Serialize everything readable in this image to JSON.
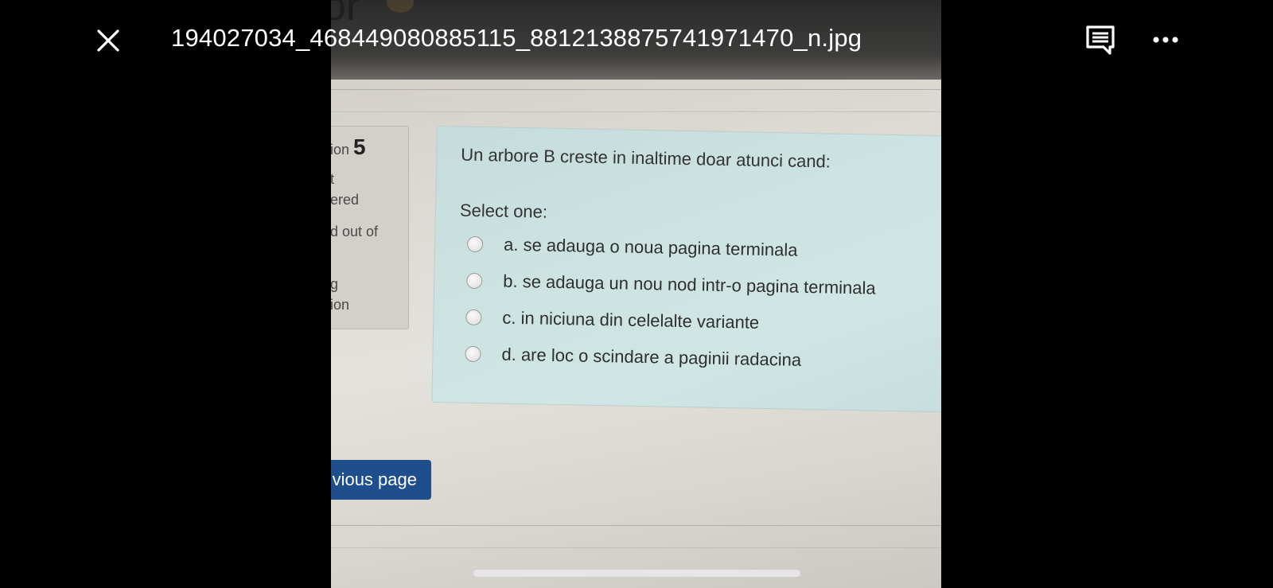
{
  "viewer": {
    "filename": "194027034_468449080885115_8812138875741971470_n.jpg",
    "close_icon": "close-icon",
    "comment_icon": "comment-icon",
    "more_icon": "more-options-icon"
  },
  "photo": {
    "ghost_text": "or",
    "sidebar": {
      "question_label": "ion",
      "question_number": "5",
      "status_line1": "t",
      "status_line2": "ered",
      "marks_line": "d out of",
      "flag_line1": "g",
      "flag_line2": "ion"
    },
    "question": {
      "text": "Un arbore B creste in inaltime doar atunci cand:",
      "prompt": "Select one:",
      "options": [
        "a. se adauga o noua pagina terminala",
        "b. se adauga un nou nod intr-o pagina terminala",
        "c. in niciuna din celelalte variante",
        "d. are loc o scindare a paginii radacina"
      ]
    },
    "prev_button_label": "vious page"
  }
}
